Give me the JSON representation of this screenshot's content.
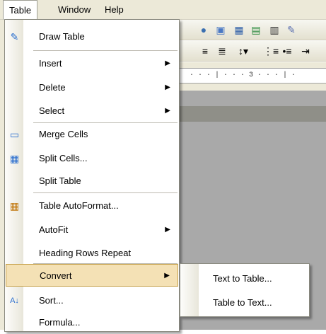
{
  "menubar": {
    "items": [
      "Table",
      "Window",
      "Help"
    ]
  },
  "ruler": {
    "text": "·  ·  ·  |  ·  ·  ·  3  ·  ·  ·  |  ·"
  },
  "table_menu": {
    "items": [
      {
        "label": "Draw Table",
        "icon": "draw-table-icon"
      },
      {
        "label": "Insert",
        "submenu": true
      },
      {
        "label": "Delete",
        "submenu": true
      },
      {
        "label": "Select",
        "submenu": true
      },
      {
        "label": "Merge Cells",
        "icon": "merge-cells-icon"
      },
      {
        "label": "Split Cells...",
        "icon": "split-cells-icon"
      },
      {
        "label": "Split Table"
      },
      {
        "label": "Table AutoFormat...",
        "icon": "autoformat-icon"
      },
      {
        "label": "AutoFit",
        "submenu": true
      },
      {
        "label": "Heading Rows Repeat"
      },
      {
        "label": "Convert",
        "submenu": true,
        "highlighted": true
      },
      {
        "label": "Sort...",
        "icon": "sort-az-icon"
      },
      {
        "label": "Formula..."
      }
    ]
  },
  "convert_submenu": {
    "items": [
      "Text to Table...",
      "Table to Text..."
    ]
  },
  "colors": {
    "highlight": "#f4e1b5",
    "highlight_border": "#c6a14a",
    "menubar": "#ece9d8"
  }
}
